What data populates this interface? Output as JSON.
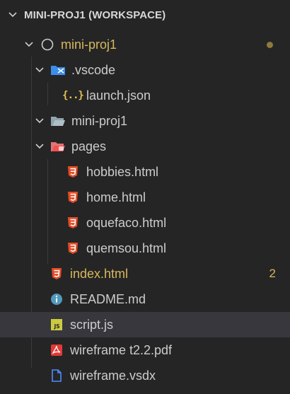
{
  "workspace": {
    "title": "MINI-PROJ1 (WORKSPACE)"
  },
  "tree": {
    "root": {
      "label": "mini-proj1"
    },
    "vscode": {
      "label": ".vscode"
    },
    "launch": {
      "label": "launch.json"
    },
    "miniproj_folder": {
      "label": "mini-proj1"
    },
    "pages": {
      "label": "pages"
    },
    "hobbies": {
      "label": "hobbies.html"
    },
    "home": {
      "label": "home.html"
    },
    "oquefaco": {
      "label": "oquefaco.html"
    },
    "quemsou": {
      "label": "quemsou.html"
    },
    "index": {
      "label": "index.html",
      "badge": "2"
    },
    "readme": {
      "label": "README.md"
    },
    "script": {
      "label": "script.js",
      "selected": true
    },
    "wireframe_pdf": {
      "label": "wireframe t2.2.pdf"
    },
    "wireframe_vsdx": {
      "label": "wireframe.vsdx"
    }
  },
  "colors": {
    "background": "#252526",
    "selected_row": "#37373d",
    "modified_text": "#d7b85c",
    "html_icon": "#e44d26",
    "js_icon": "#cbcb41",
    "info_icon": "#519aba",
    "pdf_icon": "#e53935",
    "vsdx_icon": "#4f8cff"
  }
}
